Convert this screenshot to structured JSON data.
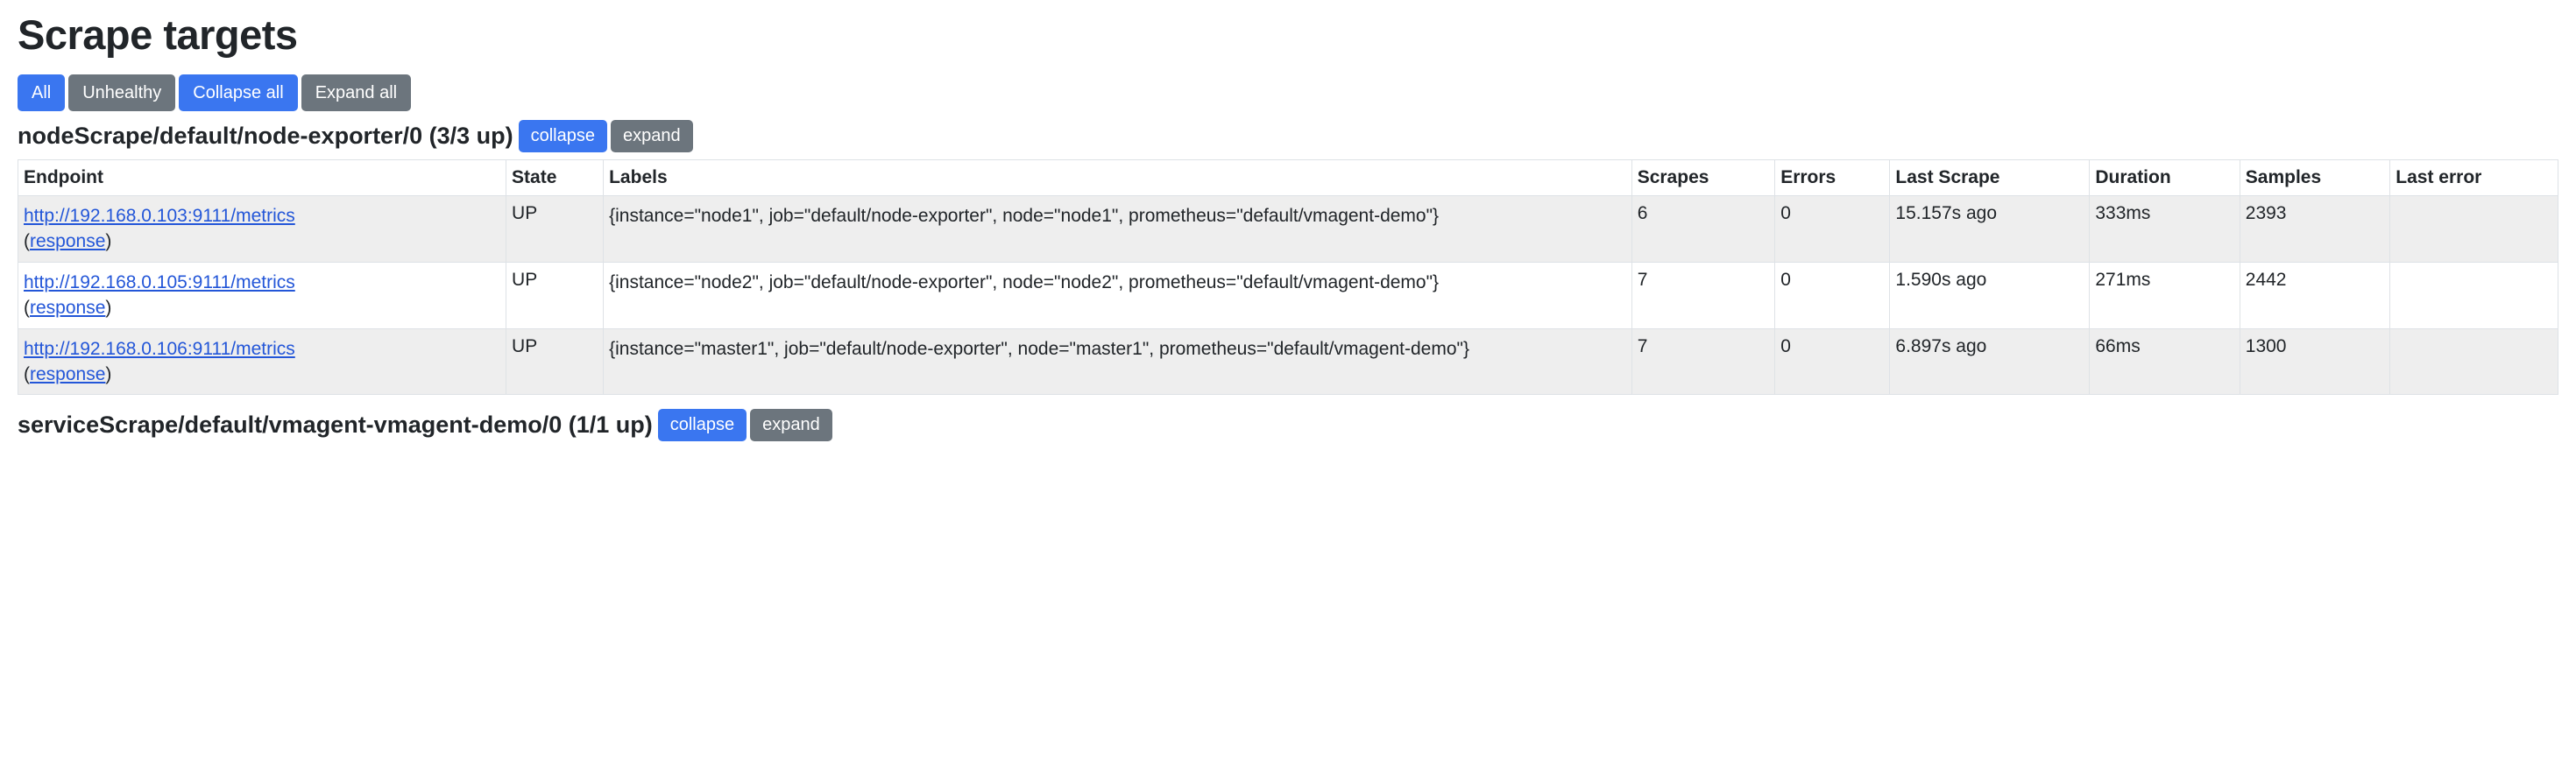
{
  "page_title": "Scrape targets",
  "filter_buttons": {
    "all": "All",
    "unhealthy": "Unhealthy",
    "collapse_all": "Collapse all",
    "expand_all": "Expand all"
  },
  "section_buttons": {
    "collapse": "collapse",
    "expand": "expand"
  },
  "table_headers": {
    "endpoint": "Endpoint",
    "state": "State",
    "labels": "Labels",
    "scrapes": "Scrapes",
    "errors": "Errors",
    "last_scrape": "Last Scrape",
    "duration": "Duration",
    "samples": "Samples",
    "last_error": "Last error"
  },
  "response_label": "response",
  "sections": [
    {
      "title": "nodeScrape/default/node-exporter/0 (3/3 up)",
      "rows": [
        {
          "endpoint": "http://192.168.0.103:9111/metrics",
          "state": "UP",
          "labels": "{instance=\"node1\", job=\"default/node-exporter\", node=\"node1\", prometheus=\"default/vmagent-demo\"}",
          "scrapes": "6",
          "errors": "0",
          "last_scrape": "15.157s ago",
          "duration": "333ms",
          "samples": "2393",
          "last_error": ""
        },
        {
          "endpoint": "http://192.168.0.105:9111/metrics",
          "state": "UP",
          "labels": "{instance=\"node2\", job=\"default/node-exporter\", node=\"node2\", prometheus=\"default/vmagent-demo\"}",
          "scrapes": "7",
          "errors": "0",
          "last_scrape": "1.590s ago",
          "duration": "271ms",
          "samples": "2442",
          "last_error": ""
        },
        {
          "endpoint": "http://192.168.0.106:9111/metrics",
          "state": "UP",
          "labels": "{instance=\"master1\", job=\"default/node-exporter\", node=\"master1\", prometheus=\"default/vmagent-demo\"}",
          "scrapes": "7",
          "errors": "0",
          "last_scrape": "6.897s ago",
          "duration": "66ms",
          "samples": "1300",
          "last_error": ""
        }
      ]
    },
    {
      "title": "serviceScrape/default/vmagent-vmagent-demo/0 (1/1 up)",
      "rows": []
    }
  ]
}
